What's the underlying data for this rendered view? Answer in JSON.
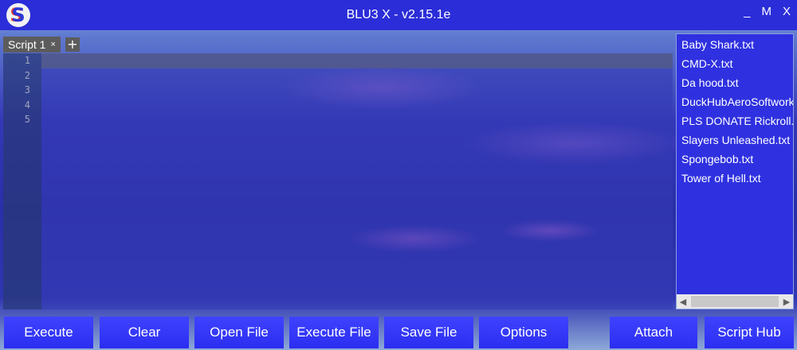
{
  "app": {
    "title": "BLU3 X - v2.15.1e",
    "logo_letter": "S"
  },
  "window_controls": {
    "minimize": "_",
    "maximize": "M",
    "close": "X"
  },
  "tabs": [
    {
      "label": "Script 1",
      "close": "×"
    }
  ],
  "tab_add": "+",
  "editor": {
    "line_numbers": [
      "1",
      "2",
      "3",
      "4",
      "5"
    ],
    "content": ""
  },
  "script_list": [
    "Baby Shark.txt",
    "CMD-X.txt",
    "Da hood.txt",
    "DuckHubAeroSoftworks.txt",
    "PLS DONATE Rickroll.txt",
    "Slayers Unleashed.txt",
    "Spongebob.txt",
    "Tower of Hell.txt"
  ],
  "buttons": {
    "execute": "Execute",
    "clear": "Clear",
    "open_file": "Open File",
    "execute_file": "Execute File",
    "save_file": "Save File",
    "options": "Options",
    "attach": "Attach",
    "script_hub": "Script Hub"
  },
  "colors": {
    "titlebar": "#2b2dd8",
    "button": "#3a3dff",
    "list_bg": "#2f31e0",
    "tab_bg": "#5c5c5c"
  }
}
